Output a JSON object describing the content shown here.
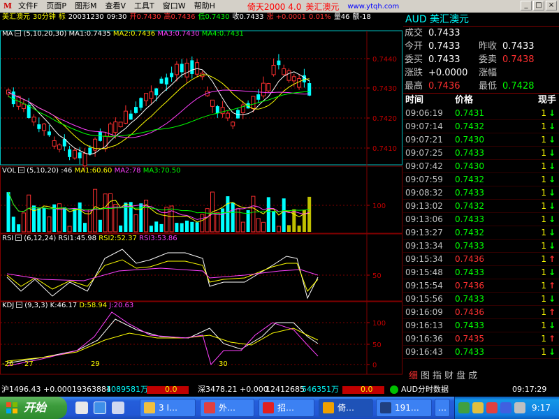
{
  "menu": {
    "logo": "M",
    "items": [
      "文件F",
      "页面P",
      "图形M",
      "查看V",
      "工具T",
      "窗口W",
      "帮助H"
    ],
    "app_title": "倚天2000  4.0",
    "app_subtitle": "美汇澳元",
    "app_url": "www.ytqh.com",
    "minimize": "_",
    "restore": "□",
    "close": "×"
  },
  "chart_header": {
    "symbol": "美汇澳元",
    "period": "30分钟",
    "mark": "标",
    "date": "20031230",
    "time": "09:30",
    "open": "开0.7430",
    "high": "高0.7436",
    "low": "低0.7430",
    "close": "收0.7433",
    "change": "涨 +0.0001",
    "change_pct": "0.01%",
    "volume": "量46",
    "amount": "额-18"
  },
  "ma": {
    "label": "MA",
    "params": "(5,10,20,30)",
    "ma1": "MA1:0.7435",
    "ma2": "MA2:0.7436",
    "ma3": "MA3:0.7430",
    "ma4": "MA4:0.7431",
    "ticks": [
      "0.7440",
      "0.7430",
      "0.7420",
      "0.7410"
    ]
  },
  "vol": {
    "label": "VOL",
    "params": "(5,10,20)",
    "value": ":46",
    "ma1": "MA1:60.60",
    "ma2": "MA2:78",
    "ma3": "MA3:70.50",
    "tick": "100"
  },
  "rsi": {
    "label": "RSI",
    "params": "(6,12,24)",
    "rsi1": "RSI1:45.98",
    "rsi2": "RSI2:52.37",
    "rsi3": "RSI3:53.86",
    "tick": "50"
  },
  "kdj": {
    "label": "KDJ",
    "params": "(9,3,3)",
    "k": "K:46.17",
    "d": "D:58.94",
    "j": "J:20.63",
    "ticks": [
      "100",
      "50",
      "0"
    ],
    "annotations": [
      "-26",
      "27",
      "29",
      "30"
    ]
  },
  "quote_panel": {
    "title": "AUD 美汇澳元",
    "last_label": "成交",
    "last_value": "0.7433",
    "rows": [
      {
        "k1": "今开",
        "v1": "0.7433",
        "k2": "昨收",
        "v2": "0.7433",
        "c1": "#ffffff",
        "c2": "#ffffff"
      },
      {
        "k1": "委买",
        "v1": "0.7433",
        "k2": "委卖",
        "v2": "0.7438",
        "c1": "#ffffff",
        "c2": "#ff3030"
      },
      {
        "k1": "涨跌",
        "v1": "+0.0000",
        "k2": "涨幅",
        "v2": "",
        "c1": "#ffffff",
        "c2": "#ffffff"
      },
      {
        "k1": "最高",
        "v1": "0.7436",
        "k2": "最低",
        "v2": "0.7428",
        "c1": "#ff3030",
        "c2": "#00ff00"
      }
    ]
  },
  "trades": {
    "headers": {
      "time": "时间",
      "price": "价格",
      "volume": "现手"
    },
    "rows": [
      {
        "time": "09:06:19",
        "price": "0.7431",
        "vol": "1",
        "dir": "down"
      },
      {
        "time": "09:07:14",
        "price": "0.7432",
        "vol": "1",
        "dir": "down"
      },
      {
        "time": "09:07:21",
        "price": "0.7430",
        "vol": "1",
        "dir": "down"
      },
      {
        "time": "09:07:25",
        "price": "0.7433",
        "vol": "1",
        "dir": "down"
      },
      {
        "time": "09:07:42",
        "price": "0.7430",
        "vol": "1",
        "dir": "down"
      },
      {
        "time": "09:07:59",
        "price": "0.7432",
        "vol": "1",
        "dir": "down"
      },
      {
        "time": "09:08:32",
        "price": "0.7433",
        "vol": "1",
        "dir": "down"
      },
      {
        "time": "09:13:02",
        "price": "0.7432",
        "vol": "1",
        "dir": "down"
      },
      {
        "time": "09:13:06",
        "price": "0.7433",
        "vol": "1",
        "dir": "down"
      },
      {
        "time": "09:13:27",
        "price": "0.7432",
        "vol": "1",
        "dir": "down"
      },
      {
        "time": "09:13:34",
        "price": "0.7433",
        "vol": "1",
        "dir": "down"
      },
      {
        "time": "09:15:34",
        "price": "0.7436",
        "vol": "1",
        "dir": "up"
      },
      {
        "time": "09:15:48",
        "price": "0.7433",
        "vol": "1",
        "dir": "down"
      },
      {
        "time": "09:15:54",
        "price": "0.7436",
        "vol": "1",
        "dir": "up"
      },
      {
        "time": "09:15:56",
        "price": "0.7433",
        "vol": "1",
        "dir": "down"
      },
      {
        "time": "09:16:09",
        "price": "0.7436",
        "vol": "1",
        "dir": "up"
      },
      {
        "time": "09:16:13",
        "price": "0.7433",
        "vol": "1",
        "dir": "down"
      },
      {
        "time": "09:16:36",
        "price": "0.7435",
        "vol": "1",
        "dir": "up"
      },
      {
        "time": "09:16:43",
        "price": "0.7433",
        "vol": "1",
        "dir": "down"
      }
    ],
    "up_color": "#ff3030",
    "down_color": "#00ff00"
  },
  "panel_tabs": [
    "细",
    "图",
    "指",
    "财",
    "盘",
    "成"
  ],
  "statusbar": {
    "sh_index": "沪1496.43 +0.000",
    "sh_vol": "19363884",
    "sh_amount": "1089581万",
    "sh_bar": "0.0",
    "sz_index": "深3478.21 +0.000",
    "sz_vol": "12412685",
    "sz_amount": "546351万",
    "sz_bar": "0.0",
    "info": "AUD分时数据",
    "clock": "09:17:29"
  },
  "taskbar": {
    "start": "开始",
    "tasks": [
      "3 I…",
      "外…",
      "招…",
      "倚…",
      "191…",
      "…"
    ],
    "clock": "9:17"
  }
}
